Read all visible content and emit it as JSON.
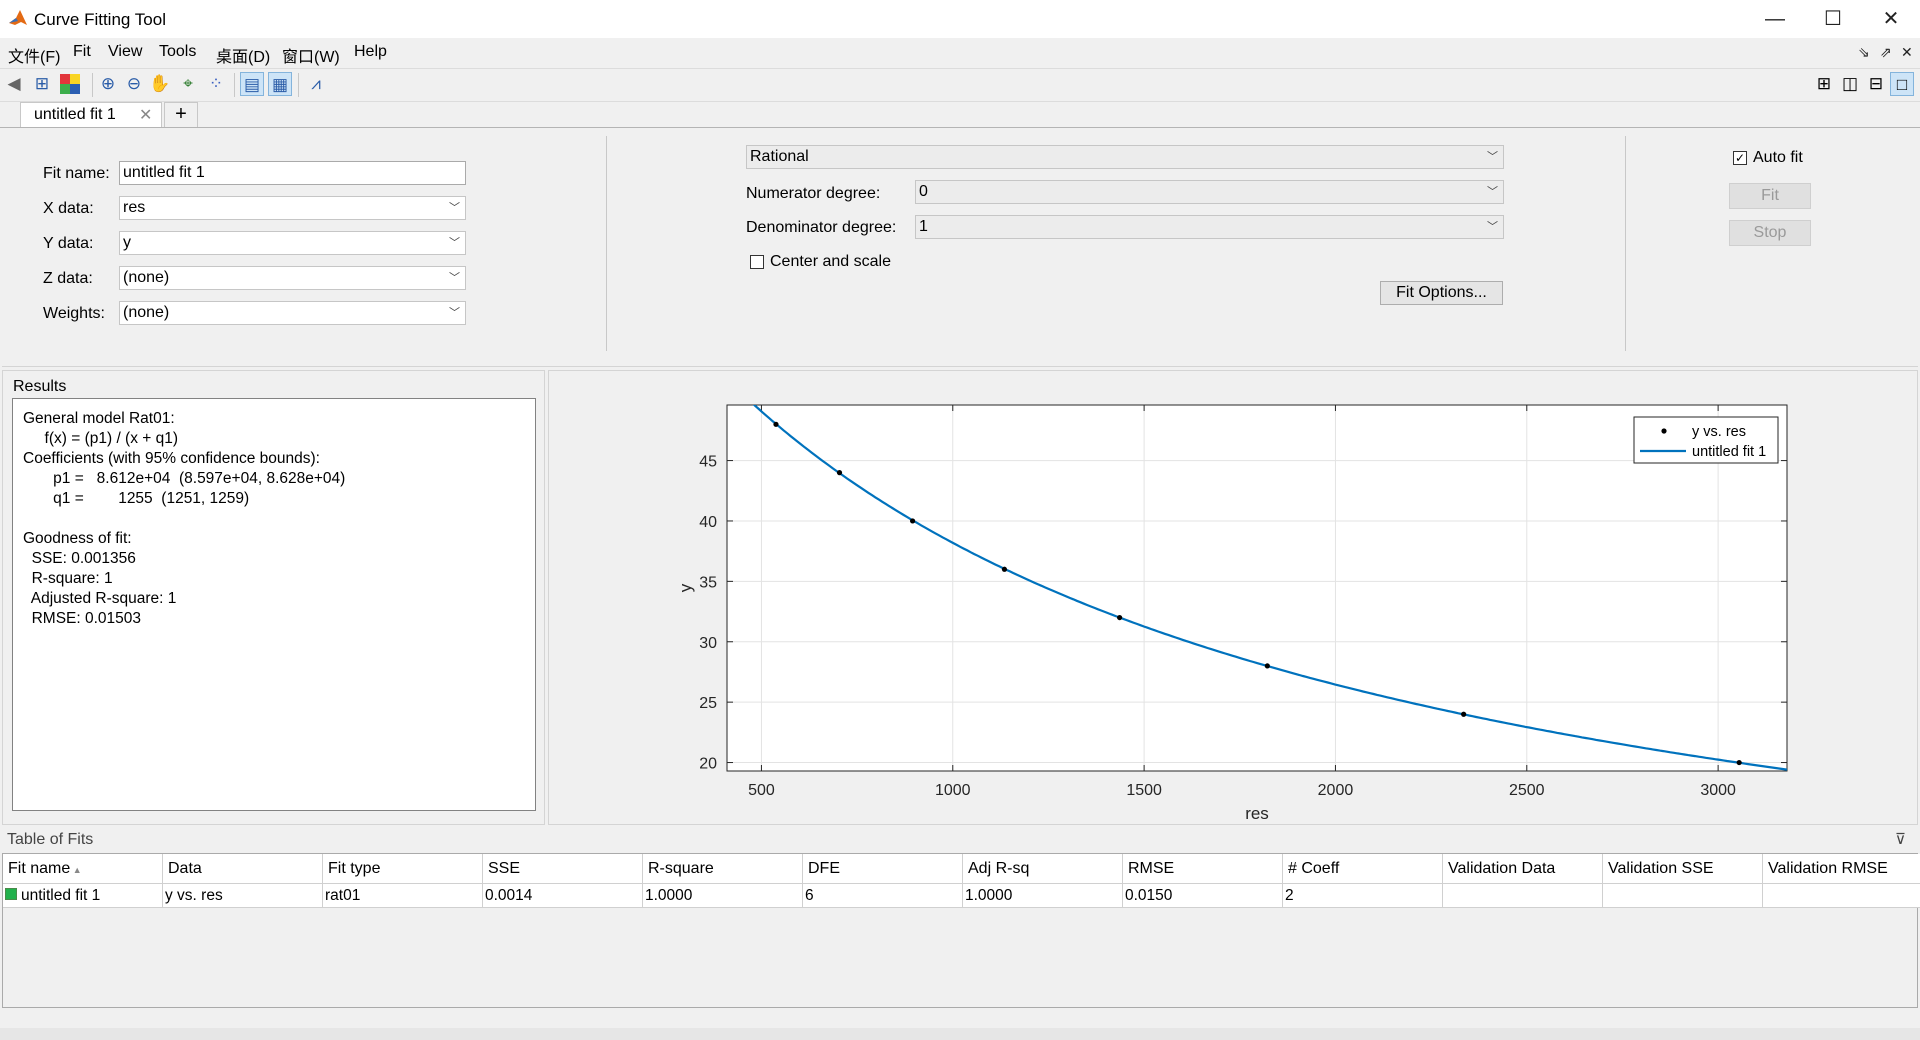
{
  "window": {
    "title": "Curve Fitting Tool",
    "minimize": "—",
    "maximize": "☐",
    "close": "✕"
  },
  "menu": [
    "文件(F)",
    "Fit",
    "View",
    "Tools",
    "桌面(D)",
    "窗口(W)",
    "Help"
  ],
  "tabs": [
    {
      "label": "untitled fit 1",
      "close": "✕"
    }
  ],
  "tab_add": "+",
  "fit_settings": {
    "fit_name_label": "Fit name:",
    "fit_name_value": "untitled fit 1",
    "x_label": "X data:",
    "x_value": "res",
    "y_label": "Y data:",
    "y_value": "y",
    "z_label": "Z data:",
    "z_value": "(none)",
    "w_label": "Weights:",
    "w_value": "(none)"
  },
  "fit_type": {
    "type_value": "Rational",
    "numerator_label": "Numerator degree:",
    "numerator_value": "0",
    "denominator_label": "Denominator degree:",
    "denominator_value": "1",
    "center_scale_label": "Center and scale",
    "center_scale_checked": false,
    "fit_options_button": "Fit Options..."
  },
  "controls": {
    "auto_fit_label": "Auto fit",
    "auto_fit_checked": true,
    "fit_button": "Fit",
    "stop_button": "Stop"
  },
  "results": {
    "title": "Results",
    "lines": [
      "General model Rat01:",
      "     f(x) = (p1) / (x + q1)",
      "Coefficients (with 95% confidence bounds):",
      "       p1 =   8.612e+04  (8.597e+04, 8.628e+04)",
      "       q1 =        1255  (1251, 1259)",
      "",
      "Goodness of fit:",
      "  SSE: 0.001356",
      "  R-square: 1",
      "  Adjusted R-square: 1",
      "  RMSE: 0.01503"
    ]
  },
  "chart_data": {
    "type": "scatter",
    "xlabel": "res",
    "ylabel": "y",
    "xlim": [
      410,
      3180
    ],
    "ylim": [
      19.3,
      49.6
    ],
    "xticks": [
      500,
      1000,
      1500,
      2000,
      2500,
      3000
    ],
    "yticks": [
      20,
      25,
      30,
      35,
      40,
      45
    ],
    "grid": true,
    "legend_position": "top-right",
    "series": [
      {
        "name": "y vs. res",
        "kind": "points",
        "color": "#000000",
        "x": [
          538,
          704,
          895,
          1135,
          1436,
          1822,
          2335,
          3055
        ],
        "y": [
          48,
          44,
          40,
          36,
          32,
          28,
          24,
          20
        ]
      },
      {
        "name": "untitled fit 1",
        "kind": "curve",
        "color": "#0072bd",
        "model": {
          "p1": 86120,
          "q1": 1255
        }
      }
    ]
  },
  "table_of_fits": {
    "title": "Table of Fits",
    "collapse_icon": "⊽",
    "columns": [
      "Fit name",
      "Data",
      "Fit type",
      "SSE",
      "R-square",
      "DFE",
      "Adj R-sq",
      "RMSE",
      "# Coeff",
      "Validation Data",
      "Validation SSE",
      "Validation RMSE"
    ],
    "sort_indicator": "▲",
    "rows": [
      [
        "untitled fit 1",
        "y vs. res",
        "rat01",
        "0.0014",
        "1.0000",
        "6",
        "1.0000",
        "0.0150",
        "2",
        "",
        "",
        ""
      ]
    ],
    "row_color": "#22b14c"
  }
}
